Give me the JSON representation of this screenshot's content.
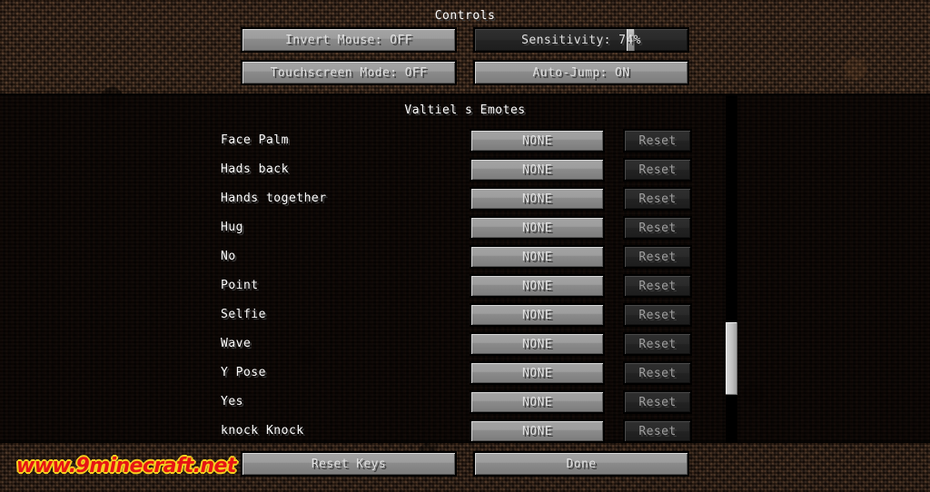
{
  "screen": {
    "title": "Controls",
    "section_title": "Valtiel s Emotes"
  },
  "options": {
    "invert_mouse": "Invert Mouse: OFF",
    "sensitivity": "Sensitivity: 74%",
    "sensitivity_percent": 74,
    "touchscreen_mode": "Touchscreen Mode: OFF",
    "auto_jump": "Auto-Jump: ON"
  },
  "bindings": [
    {
      "label": "Face Palm",
      "key": "NONE",
      "reset": "Reset"
    },
    {
      "label": "Hads back",
      "key": "NONE",
      "reset": "Reset"
    },
    {
      "label": "Hands together",
      "key": "NONE",
      "reset": "Reset"
    },
    {
      "label": "Hug",
      "key": "NONE",
      "reset": "Reset"
    },
    {
      "label": "No",
      "key": "NONE",
      "reset": "Reset"
    },
    {
      "label": "Point",
      "key": "NONE",
      "reset": "Reset"
    },
    {
      "label": "Selfie",
      "key": "NONE",
      "reset": "Reset"
    },
    {
      "label": "Wave",
      "key": "NONE",
      "reset": "Reset"
    },
    {
      "label": "Y Pose",
      "key": "NONE",
      "reset": "Reset"
    },
    {
      "label": "Yes",
      "key": "NONE",
      "reset": "Reset"
    },
    {
      "label": "knock Knock",
      "key": "NONE",
      "reset": "Reset"
    }
  ],
  "footer": {
    "reset_keys": "Reset Keys",
    "done": "Done"
  },
  "watermark": "www.9minecraft.net",
  "colors": {
    "button_face": "#9e9e9e",
    "button_text": "#e0e0e0",
    "disabled_face": "#2a2a2a",
    "disabled_text": "#a0a0a0",
    "background": "#38251a",
    "watermark_fill": "#e61414",
    "watermark_outline": "#f5d020"
  }
}
